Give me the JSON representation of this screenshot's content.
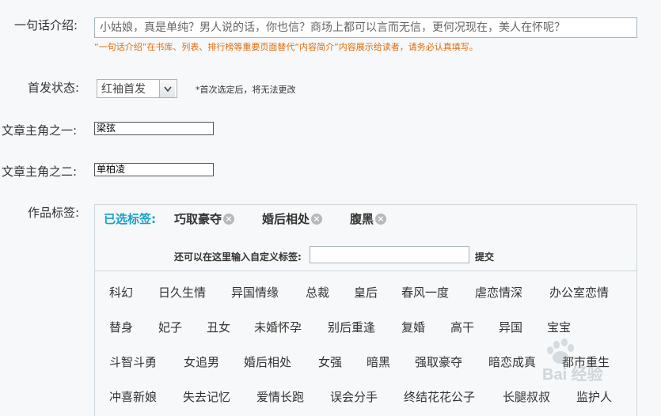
{
  "form": {
    "oneline_label": "一句话介绍:",
    "oneline_value": "小姑娘，真是单纯？男人说的话，你也信？商场上都可以言而无信，更何况现在，美人在怀呢？",
    "oneline_hint": "“一句话介绍”在书库、列表、排行榜等重要页面替代“内容简介”内容展示给读者，请务必认真填写。",
    "publish_label": "首发状态:",
    "publish_value": "红袖首发",
    "publish_hint": "*首次选定后，将无法更改",
    "hero1_label": "文章主角之一:",
    "hero1_value": "梁弦",
    "hero2_label": "文章主角之二:",
    "hero2_value": "单柏凌",
    "tags_label": "作品标签:"
  },
  "tags": {
    "selected_label": "已选标签:",
    "selected": [
      "巧取豪夺",
      "婚后相处",
      "腹黑"
    ],
    "remove_glyph": "×",
    "custom_label": "还可以在这里输入自定义标签:",
    "custom_value": "",
    "submit_label": "提交",
    "rows": [
      [
        "科幻",
        "日久生情",
        "异国情缘",
        "总裁",
        "皇后",
        "春风一度",
        "虐恋情深",
        "办公室恋情"
      ],
      [
        "替身",
        "妃子",
        "丑女",
        "未婚怀孕",
        "别后重逢",
        "复婚",
        "高干",
        "异国",
        "宝宝"
      ],
      [
        "斗智斗勇",
        "女追男",
        "婚后相处",
        "女强",
        "暗黑",
        "强取豪夺",
        "暗恋成真",
        "都市重生"
      ],
      [
        "冲喜新娘",
        "失去记忆",
        "爱情长跑",
        "误会分手",
        "终结花花公子",
        "长腿叔叔",
        "监护人"
      ]
    ]
  },
  "watermark": {
    "text": "Bai 经验"
  }
}
